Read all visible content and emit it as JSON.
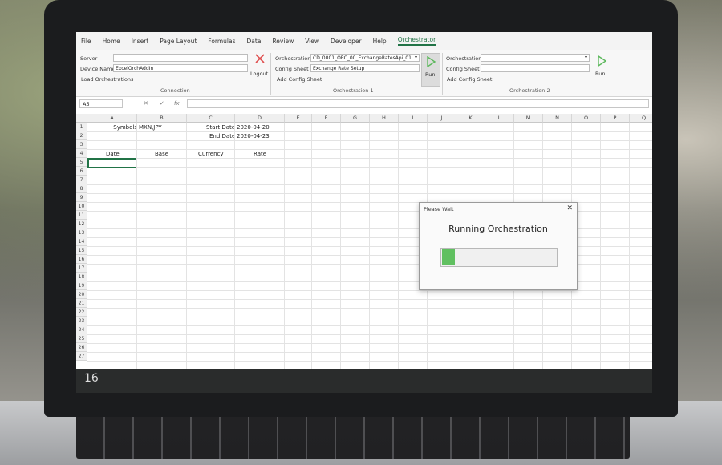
{
  "ribbon_tabs": [
    "File",
    "Home",
    "Insert",
    "Page Layout",
    "Formulas",
    "Data",
    "Review",
    "View",
    "Developer",
    "Help",
    "Orchestrator"
  ],
  "active_tab": "Orchestrator",
  "connection": {
    "server_label": "Server",
    "server_value": "",
    "device_label": "Device Name",
    "device_value": "ExcelOrchAddIn",
    "logout_label": "Logout",
    "load_label": "Load Orchestrations",
    "group_label": "Connection"
  },
  "orch1": {
    "orch_label": "Orchestration",
    "orch_value": "CD_0001_ORC_00_ExchangeRatesApi_01",
    "config_label": "Config Sheet",
    "config_value": "Exchange Rate Setup",
    "add_label": "Add Config Sheet",
    "run_label": "Run",
    "group_label": "Orchestration 1"
  },
  "orch2": {
    "orch_label": "Orchestration",
    "orch_value": "",
    "config_label": "Config Sheet",
    "config_value": "",
    "add_label": "Add Config Sheet",
    "run_label": "Run",
    "group_label": "Orchestration 2"
  },
  "formula_bar": {
    "name_box": "A5",
    "fx": "fx"
  },
  "columns": [
    "A",
    "B",
    "C",
    "D",
    "E",
    "F",
    "G",
    "H",
    "I",
    "J",
    "K",
    "L",
    "M",
    "N",
    "O",
    "P",
    "Q"
  ],
  "rows": [
    "1",
    "2",
    "3",
    "4",
    "5",
    "6",
    "7",
    "8",
    "9",
    "10",
    "11",
    "12",
    "13",
    "14",
    "15",
    "16",
    "17",
    "18",
    "19",
    "20",
    "21",
    "22",
    "23",
    "24",
    "25",
    "26",
    "27"
  ],
  "cells": {
    "b1_label": "Symbols",
    "b1_value": "MXN,JPY",
    "c1_label": "Start Date",
    "d1_value": "2020-04-20",
    "c2_label": "End Date",
    "d2_value": "2020-04-23",
    "h_date": "Date",
    "h_base": "Base",
    "h_currency": "Currency",
    "h_rate": "Rate"
  },
  "dialog": {
    "title": "Please Wait",
    "close": "✕",
    "message": "Running Orchestration",
    "progress": 0.11
  },
  "bottom_row_number": "16",
  "colors": {
    "accent": "#217346",
    "progress": "#60c060",
    "close_x": "#e05050",
    "run": "#5cb85c"
  }
}
